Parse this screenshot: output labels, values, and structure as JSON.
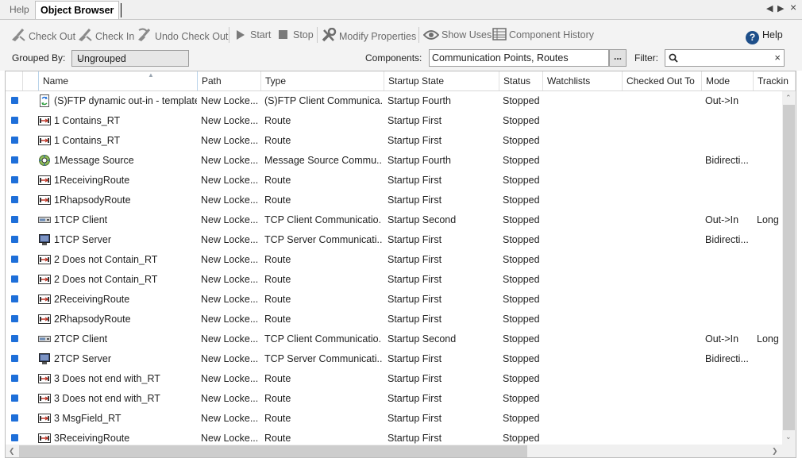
{
  "tabs": {
    "help_label": "Help",
    "active_label": "Object Browser"
  },
  "toolbar": {
    "check_out": "Check Out",
    "check_in": "Check In",
    "undo_check_out": "Undo Check Out",
    "start": "Start",
    "stop": "Stop",
    "modify_properties": "Modify Properties",
    "show_uses": "Show Uses",
    "component_history": "Component History",
    "help": "Help",
    "disabled_color": "#6b6b6b"
  },
  "filters": {
    "grouped_by_label": "Grouped By:",
    "grouped_by_value": "Ungrouped",
    "components_label": "Components:",
    "components_value": "Communication Points, Routes",
    "browse_label": "...",
    "filter_label": "Filter:",
    "filter_value": ""
  },
  "columns": [
    "Name",
    "Path",
    "Type",
    "Startup State",
    "Status",
    "Watchlists",
    "Checked Out To",
    "Mode",
    "Trackin"
  ],
  "rows": [
    {
      "icon": "sftp-icon",
      "name": "(S)FTP dynamic out-in - template",
      "path": "New Locke...",
      "type": "(S)FTP Client Communica...",
      "startup": "Startup Fourth",
      "status": "Stopped",
      "watchlists": "",
      "checked_out": "",
      "mode": "Out->In",
      "tracking": ""
    },
    {
      "icon": "route-icon",
      "name": "1 Contains_RT",
      "path": "New Locke...",
      "type": "Route",
      "startup": "Startup First",
      "status": "Stopped",
      "watchlists": "",
      "checked_out": "",
      "mode": "",
      "tracking": ""
    },
    {
      "icon": "route-icon",
      "name": "1 Contains_RT",
      "path": "New Locke...",
      "type": "Route",
      "startup": "Startup First",
      "status": "Stopped",
      "watchlists": "",
      "checked_out": "",
      "mode": "",
      "tracking": ""
    },
    {
      "icon": "message-source-icon",
      "name": "1Message Source",
      "path": "New Locke...",
      "type": "Message Source Commu...",
      "startup": "Startup Fourth",
      "status": "Stopped",
      "watchlists": "",
      "checked_out": "",
      "mode": "Bidirecti...",
      "tracking": ""
    },
    {
      "icon": "route-icon",
      "name": "1ReceivingRoute",
      "path": "New Locke...",
      "type": "Route",
      "startup": "Startup First",
      "status": "Stopped",
      "watchlists": "",
      "checked_out": "",
      "mode": "",
      "tracking": ""
    },
    {
      "icon": "route-icon",
      "name": "1RhapsodyRoute",
      "path": "New Locke...",
      "type": "Route",
      "startup": "Startup First",
      "status": "Stopped",
      "watchlists": "",
      "checked_out": "",
      "mode": "",
      "tracking": ""
    },
    {
      "icon": "tcp-client-icon",
      "name": "1TCP Client",
      "path": "New Locke...",
      "type": "TCP Client Communicatio...",
      "startup": "Startup Second",
      "status": "Stopped",
      "watchlists": "",
      "checked_out": "",
      "mode": "Out->In",
      "tracking": "Long r"
    },
    {
      "icon": "tcp-server-icon",
      "name": "1TCP Server",
      "path": "New Locke...",
      "type": "TCP Server Communicati...",
      "startup": "Startup First",
      "status": "Stopped",
      "watchlists": "",
      "checked_out": "",
      "mode": "Bidirecti...",
      "tracking": ""
    },
    {
      "icon": "route-icon",
      "name": "2 Does not Contain_RT",
      "path": "New Locke...",
      "type": "Route",
      "startup": "Startup First",
      "status": "Stopped",
      "watchlists": "",
      "checked_out": "",
      "mode": "",
      "tracking": ""
    },
    {
      "icon": "route-icon",
      "name": "2 Does not Contain_RT",
      "path": "New Locke...",
      "type": "Route",
      "startup": "Startup First",
      "status": "Stopped",
      "watchlists": "",
      "checked_out": "",
      "mode": "",
      "tracking": ""
    },
    {
      "icon": "route-icon",
      "name": "2ReceivingRoute",
      "path": "New Locke...",
      "type": "Route",
      "startup": "Startup First",
      "status": "Stopped",
      "watchlists": "",
      "checked_out": "",
      "mode": "",
      "tracking": ""
    },
    {
      "icon": "route-icon",
      "name": "2RhapsodyRoute",
      "path": "New Locke...",
      "type": "Route",
      "startup": "Startup First",
      "status": "Stopped",
      "watchlists": "",
      "checked_out": "",
      "mode": "",
      "tracking": ""
    },
    {
      "icon": "tcp-client-icon",
      "name": "2TCP Client",
      "path": "New Locke...",
      "type": "TCP Client Communicatio...",
      "startup": "Startup Second",
      "status": "Stopped",
      "watchlists": "",
      "checked_out": "",
      "mode": "Out->In",
      "tracking": "Long r"
    },
    {
      "icon": "tcp-server-icon",
      "name": "2TCP Server",
      "path": "New Locke...",
      "type": "TCP Server Communicati...",
      "startup": "Startup First",
      "status": "Stopped",
      "watchlists": "",
      "checked_out": "",
      "mode": "Bidirecti...",
      "tracking": ""
    },
    {
      "icon": "route-icon",
      "name": "3 Does not end with_RT",
      "path": "New Locke...",
      "type": "Route",
      "startup": "Startup First",
      "status": "Stopped",
      "watchlists": "",
      "checked_out": "",
      "mode": "",
      "tracking": ""
    },
    {
      "icon": "route-icon",
      "name": "3 Does not end with_RT",
      "path": "New Locke...",
      "type": "Route",
      "startup": "Startup First",
      "status": "Stopped",
      "watchlists": "",
      "checked_out": "",
      "mode": "",
      "tracking": ""
    },
    {
      "icon": "route-icon",
      "name": "3 MsgField_RT",
      "path": "New Locke...",
      "type": "Route",
      "startup": "Startup First",
      "status": "Stopped",
      "watchlists": "",
      "checked_out": "",
      "mode": "",
      "tracking": ""
    },
    {
      "icon": "route-icon",
      "name": "3ReceivingRoute",
      "path": "New Locke...",
      "type": "Route",
      "startup": "Startup First",
      "status": "Stopped",
      "watchlists": "",
      "checked_out": "",
      "mode": "",
      "tracking": ""
    }
  ],
  "colors": {
    "selection_marker": "#1e6fd9",
    "help_icon": "#1e4f8a"
  }
}
